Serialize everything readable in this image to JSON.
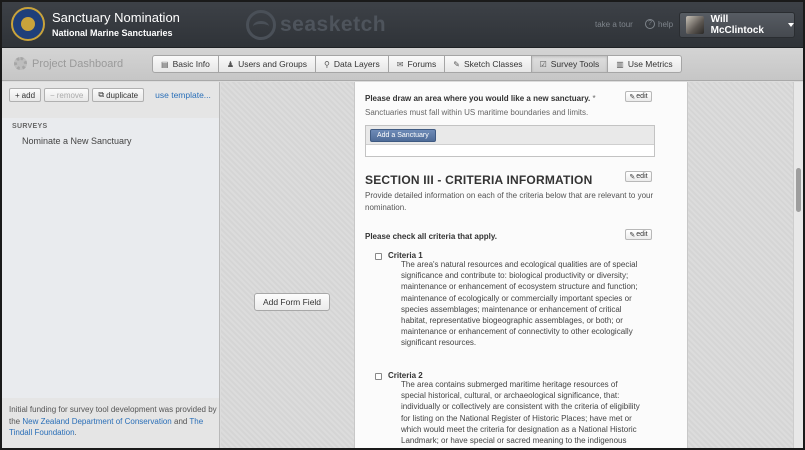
{
  "header": {
    "title": "Sanctuary Nomination",
    "subtitle": "National Marine Sanctuaries",
    "brand": "seasketch",
    "tour_label": "take a tour",
    "help_label": "help",
    "help_glyph": "?",
    "user_name": "Will McClintock"
  },
  "dashboard": {
    "title": "Project Dashboard",
    "tabs": [
      {
        "label": "Basic Info",
        "icon": "list-icon",
        "glyph": "▤"
      },
      {
        "label": "Users and Groups",
        "icon": "user-icon",
        "glyph": "♟"
      },
      {
        "label": "Data Layers",
        "icon": "map-pin-icon",
        "glyph": "⚲"
      },
      {
        "label": "Forums",
        "icon": "chat-icon",
        "glyph": "✉"
      },
      {
        "label": "Sketch Classes",
        "icon": "pencil-icon",
        "glyph": "✎"
      },
      {
        "label": "Survey Tools",
        "icon": "check-icon",
        "glyph": "☑",
        "active": true
      },
      {
        "label": "Use Metrics",
        "icon": "bar-chart-icon",
        "glyph": "▥"
      }
    ]
  },
  "sidebar": {
    "add_label": "add",
    "remove_label": "remove",
    "duplicate_label": "duplicate",
    "template_link": "use template...",
    "section_label": "SURVEYS",
    "items": [
      "Nominate a New Sanctuary"
    ],
    "footer_prefix": "Initial funding for survey tool development was provided by the ",
    "footer_link1": "New Zealand Department of Conservation",
    "footer_mid": " and ",
    "footer_link2": "The Tindall Foundation",
    "footer_suffix": "."
  },
  "main": {
    "add_field_label": "Add Form Field",
    "edit_label": "edit",
    "draw_question": "Please draw an area where you would like a new sanctuary.",
    "required_mark": "*",
    "draw_hint": "Sanctuaries must fall within US maritime boundaries and limits.",
    "add_sanctuary_label": "Add a Sanctuary",
    "section_title": "SECTION III - CRITERIA INFORMATION",
    "section_desc": "Provide detailed information on each of the criteria below that are relevant to your nomination.",
    "check_question": "Please check all criteria that apply.",
    "criteria": [
      {
        "name": "Criteria 1",
        "text": "The area's natural resources and ecological qualities are of special significance and contribute to: biological productivity or diversity; maintenance or enhancement of ecosystem structure and function; maintenance of ecologically or commercially important species or species assemblages; maintenance or enhancement of critical habitat, representative biogeographic assemblages, or both; or maintenance or enhancement of connectivity to other ecologically significant resources."
      },
      {
        "name": "Criteria 2",
        "text": "The area contains submerged maritime heritage resources of special historical, cultural, or archaeological significance, that: individually or collectively are consistent with the criteria of eligibility for listing on the National Register of Historic Places; have met or which would meet the criteria for designation as a National Historic Landmark; or have special or sacred meaning to the indigenous people of the region or nation."
      }
    ]
  }
}
